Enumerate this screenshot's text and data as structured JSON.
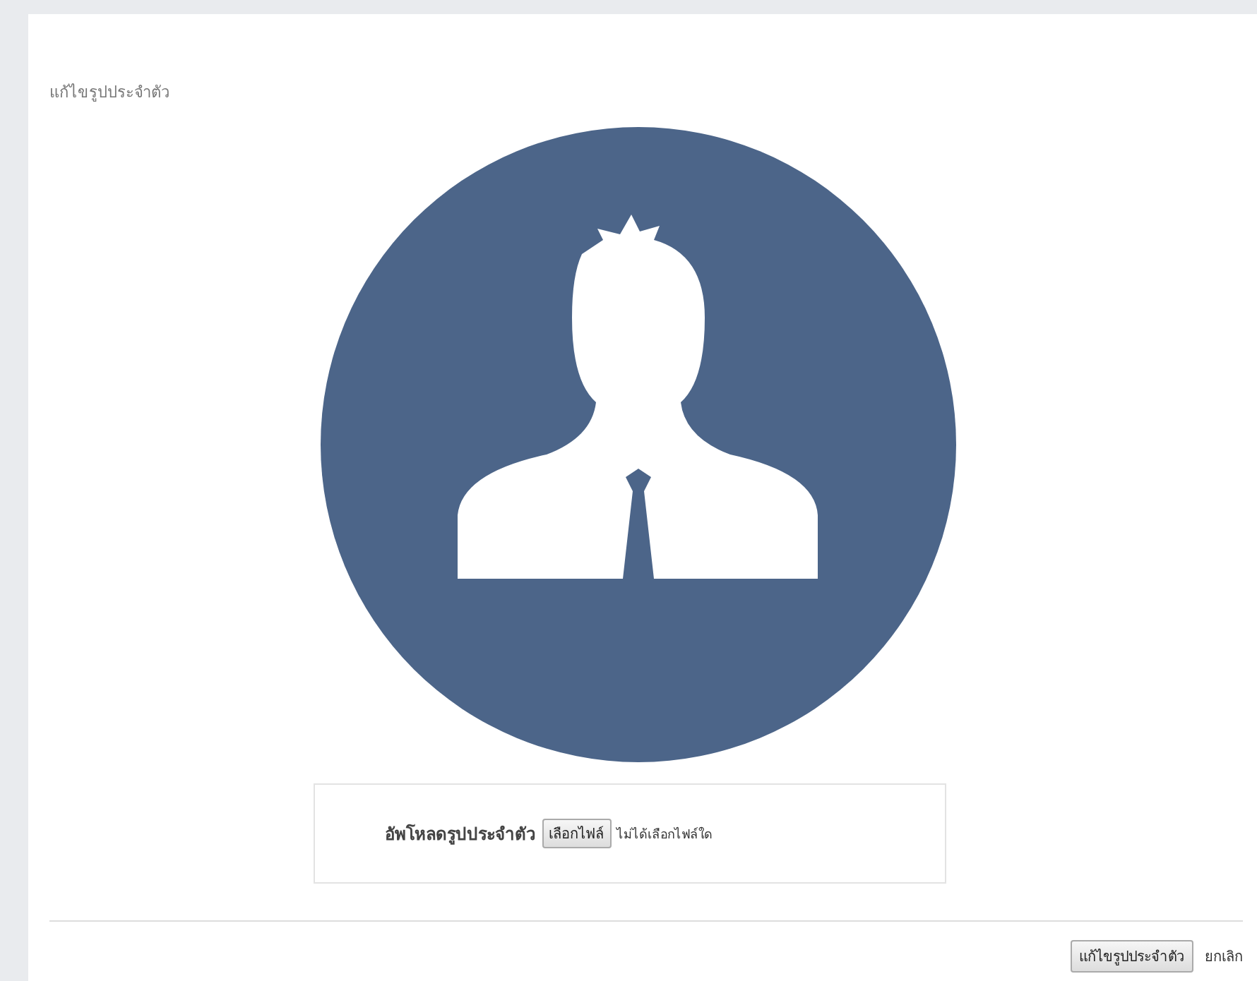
{
  "panel": {
    "title": "แก้ไขรูปประจำตัว"
  },
  "upload": {
    "label": "อัพโหลดรูปประจำตัว",
    "button": "เลือกไฟล์",
    "status": "ไม่ได้เลือกไฟล์ใด"
  },
  "actions": [
    {
      "kind": "button",
      "label": "แก้ไขรูปประจำตัว"
    },
    {
      "kind": "link",
      "label": "ยกเลิก"
    }
  ]
}
